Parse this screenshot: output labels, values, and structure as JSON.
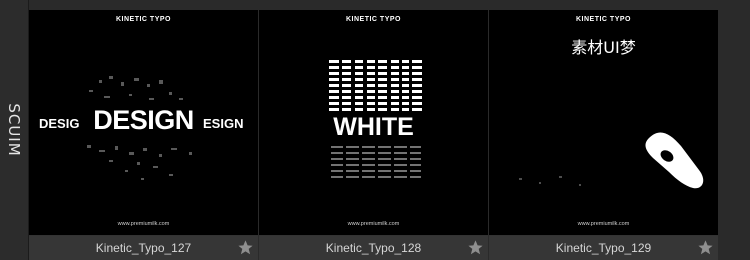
{
  "side_tab": {
    "label": "SCUIM"
  },
  "cards": [
    {
      "header": "KINETIC TYPO",
      "footer": "www.premiumilk.com",
      "title": "Kinetic_Typo_127",
      "art": {
        "main": "DESIGN",
        "left": "DESIG",
        "right": "ESIGN"
      }
    },
    {
      "header": "KINETIC TYPO",
      "footer": "www.premiumilk.com",
      "title": "Kinetic_Typo_128",
      "art": {
        "word": "WHITE"
      }
    },
    {
      "header": "KINETIC TYPO",
      "footer": "www.premiumilk.com",
      "title": "Kinetic_Typo_129",
      "watermark": "素材UI梦"
    }
  ],
  "colors": {
    "background": "#2a2a2a",
    "thumb_bg": "#000000",
    "title_bar": "#363636",
    "title_text": "#d6d6d6",
    "star": "#8f8f8f"
  },
  "icons": {
    "favorite": "star-icon"
  }
}
